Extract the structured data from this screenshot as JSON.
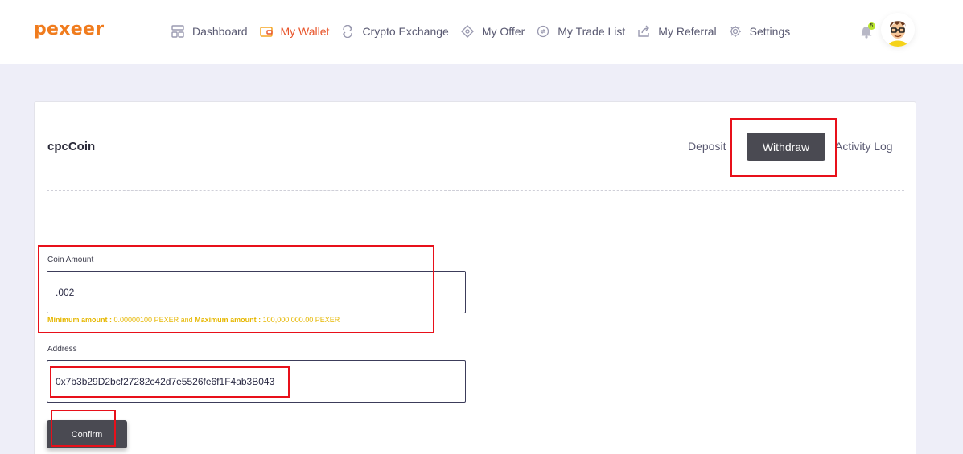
{
  "app": {
    "logo": "pexeer"
  },
  "nav": {
    "items": [
      {
        "label": "Dashboard",
        "icon": "dashboard-icon",
        "active": false
      },
      {
        "label": "My Wallet",
        "icon": "wallet-icon",
        "active": true
      },
      {
        "label": "Crypto Exchange",
        "icon": "exchange-icon",
        "active": false
      },
      {
        "label": "My Offer",
        "icon": "offer-icon",
        "active": false
      },
      {
        "label": "My Trade List",
        "icon": "trade-list-icon",
        "active": false
      },
      {
        "label": "My Referral",
        "icon": "referral-icon",
        "active": false
      },
      {
        "label": "Settings",
        "icon": "settings-icon",
        "active": false
      }
    ]
  },
  "header": {
    "notification_count": "5",
    "bell_icon": "bell-icon",
    "avatar_icon": "user-avatar-icon"
  },
  "colors": {
    "accent": "#e8542a",
    "logo": "#f07c1e",
    "dark_button": "#4a4a52",
    "hint": "#e6b700",
    "highlight": "#e8101a",
    "badge": "#b9e62e"
  },
  "card": {
    "title": "cpcCoin",
    "tabs": {
      "deposit": "Deposit",
      "withdraw": "Withdraw",
      "activity": "Activity Log"
    },
    "amount": {
      "label": "Coin Amount",
      "value": ".002",
      "min_label": "Minimum amount :",
      "min_value": "0.00000100 PEXER",
      "and": "and",
      "max_label": "Maximum amount :",
      "max_value": "100,000,000.00 PEXER"
    },
    "address": {
      "label": "Address",
      "value": "0x7b3b29D2bcf27282c42d7e5526fe6f1F4ab3B043"
    },
    "confirm_label": "Confirm"
  }
}
